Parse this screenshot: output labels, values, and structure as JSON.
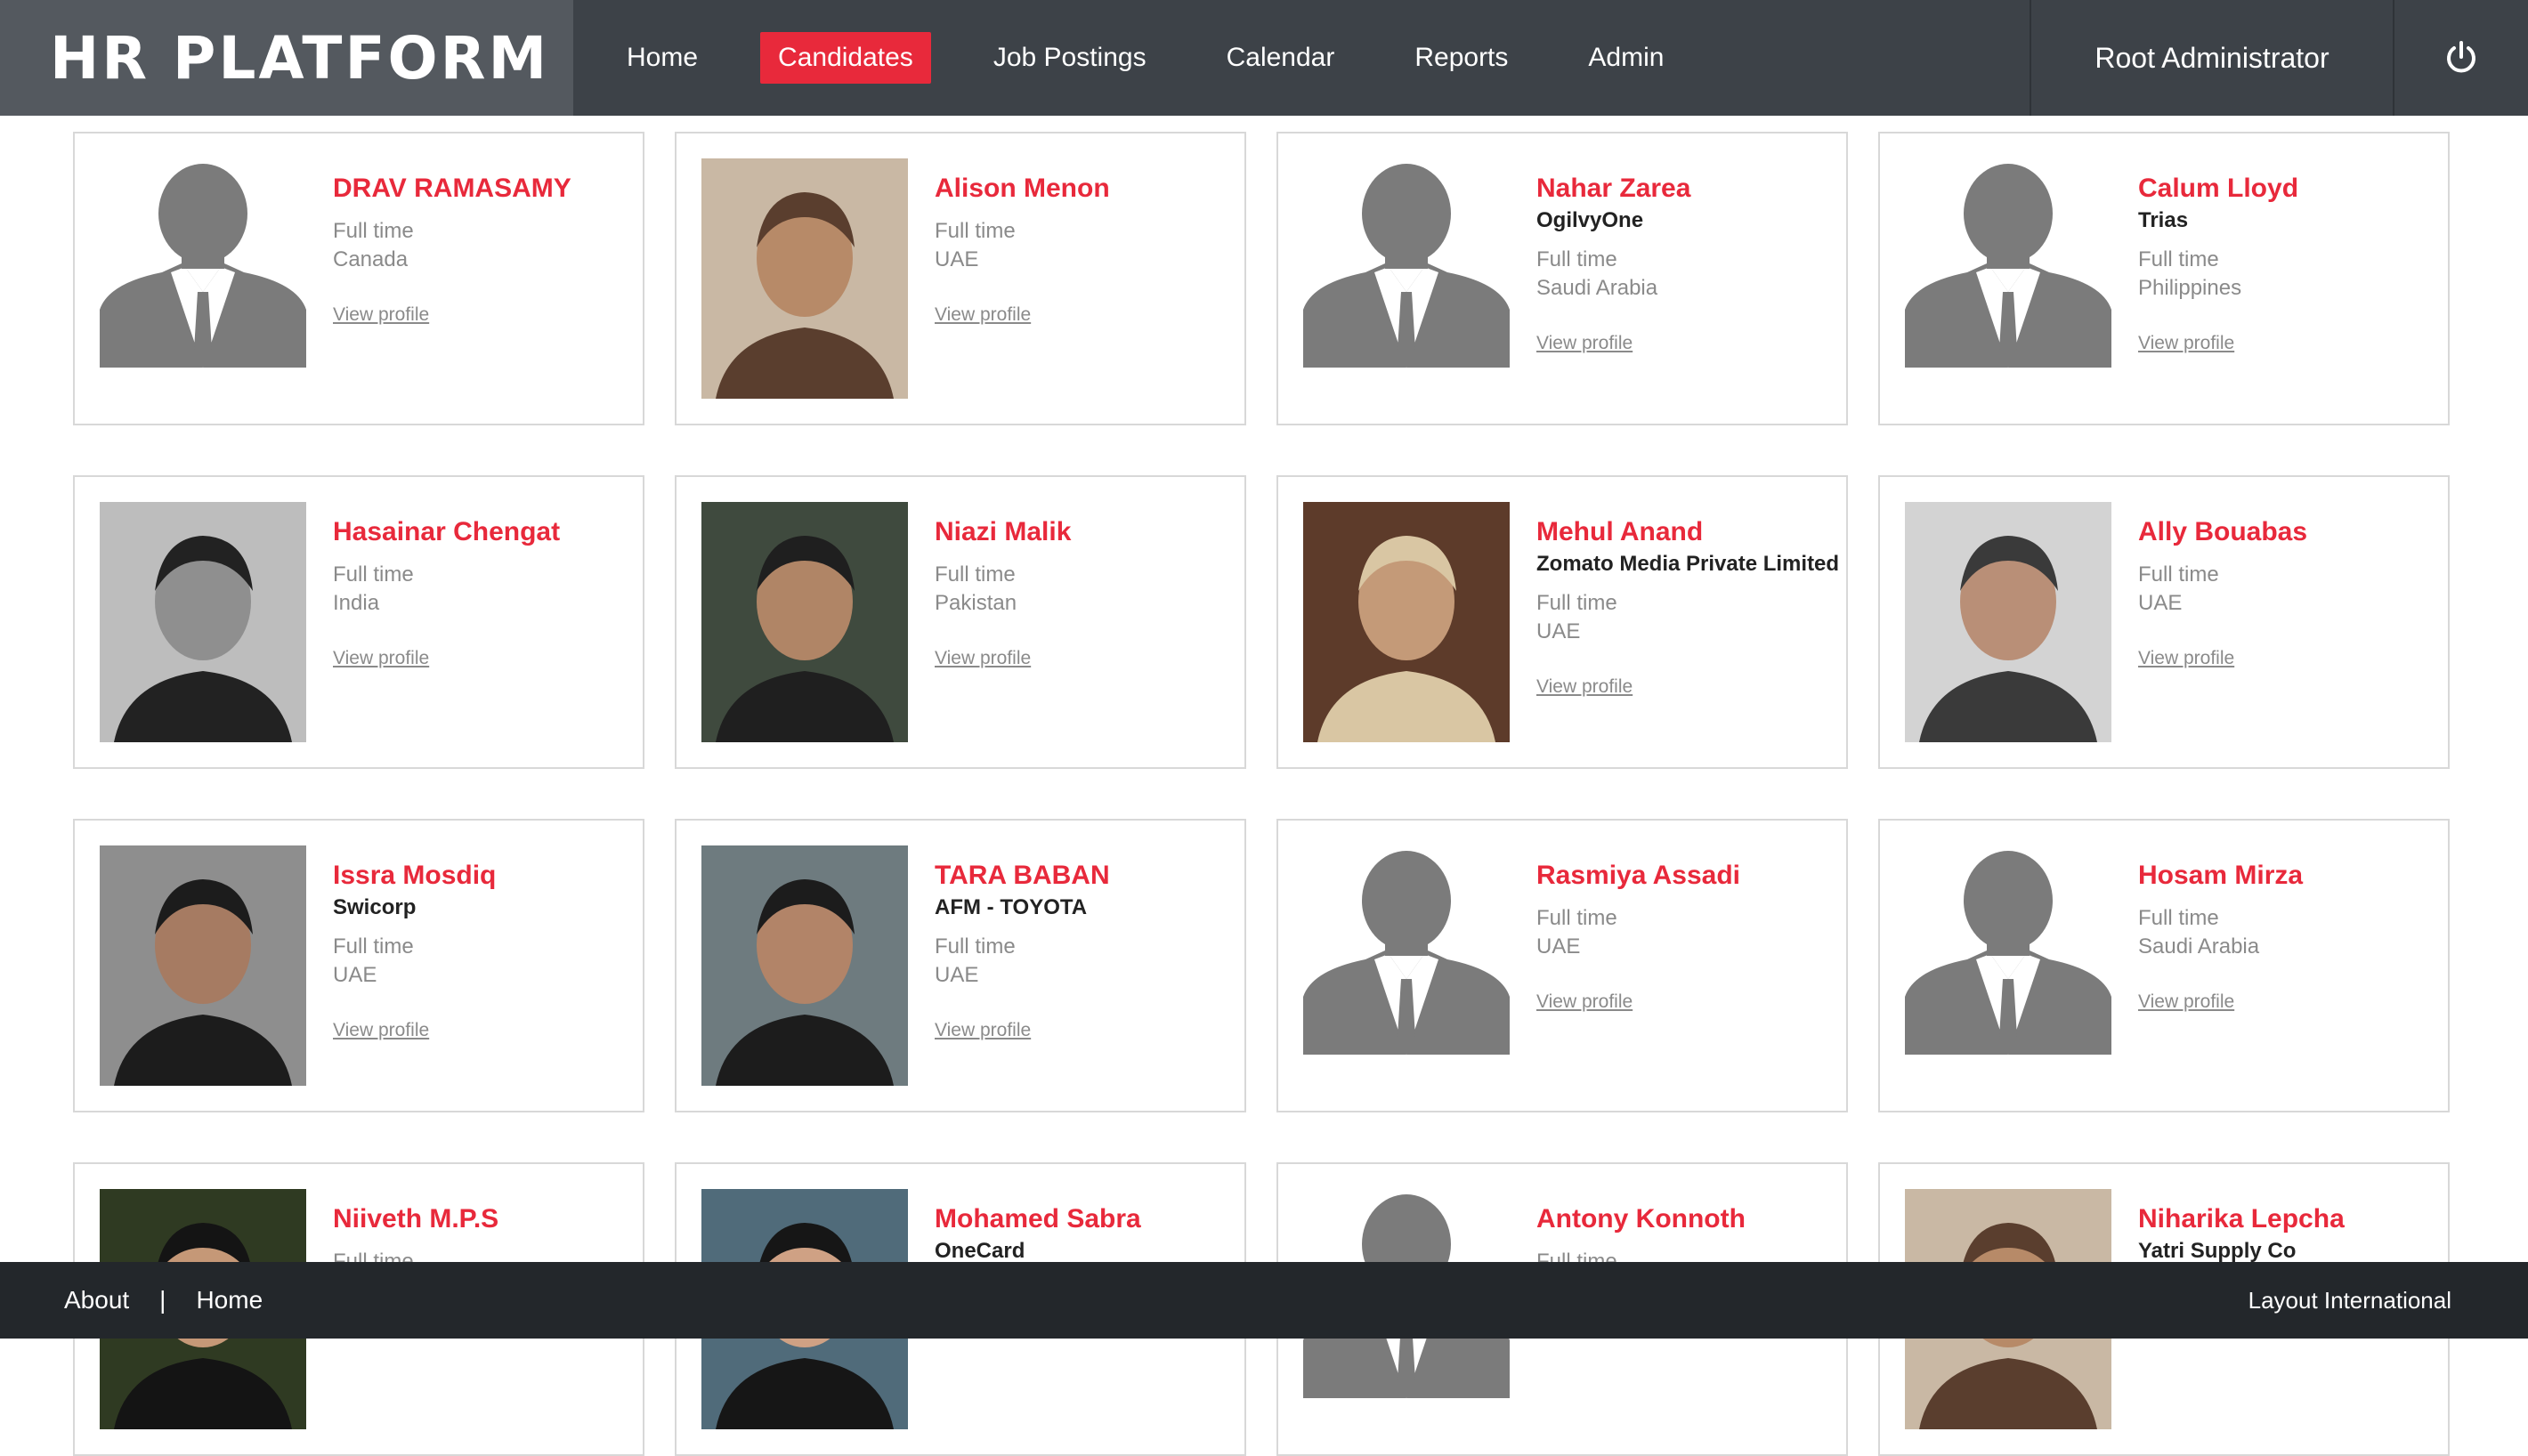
{
  "app": {
    "logo": "HR PLATFORM",
    "user": "Root Administrator"
  },
  "nav": [
    {
      "label": "Home",
      "active": false
    },
    {
      "label": "Candidates",
      "active": true
    },
    {
      "label": "Job Postings",
      "active": false
    },
    {
      "label": "Calendar",
      "active": false
    },
    {
      "label": "Reports",
      "active": false
    },
    {
      "label": "Admin",
      "active": false
    }
  ],
  "icons": {
    "power": "power-icon",
    "placeholder": "person-silhouette-icon"
  },
  "colors": {
    "accent": "#e8293b",
    "header": "#3d4248",
    "logo_bg": "#54595f",
    "footer": "#23272b",
    "silhouette": "#7b7b7b"
  },
  "candidates": [
    {
      "name": "DRAV RAMASAMY",
      "company": "",
      "type": "Full time",
      "location": "Canada",
      "link": "View profile",
      "photo": "placeholder"
    },
    {
      "name": "Alison Menon",
      "company": "",
      "type": "Full time",
      "location": "UAE",
      "link": "View profile",
      "photo": "photo"
    },
    {
      "name": "Nahar Zarea",
      "company": "OgilvyOne",
      "type": "Full time",
      "location": "Saudi Arabia",
      "link": "View profile",
      "photo": "placeholder"
    },
    {
      "name": "Calum Lloyd",
      "company": "Trias",
      "type": "Full time",
      "location": "Philippines",
      "link": "View profile",
      "photo": "placeholder"
    },
    {
      "name": "Hasainar Chengat",
      "company": "",
      "type": "Full time",
      "location": "India",
      "link": "View profile",
      "photo": "photo"
    },
    {
      "name": "Niazi Malik",
      "company": "",
      "type": "Full time",
      "location": "Pakistan",
      "link": "View profile",
      "photo": "photo"
    },
    {
      "name": "Mehul Anand",
      "company": "Zomato Media Private Limited",
      "type": "Full time",
      "location": "UAE",
      "link": "View profile",
      "photo": "photo"
    },
    {
      "name": "Ally Bouabas",
      "company": "",
      "type": "Full time",
      "location": "UAE",
      "link": "View profile",
      "photo": "photo"
    },
    {
      "name": "Issra Mosdiq",
      "company": "Swicorp",
      "type": "Full time",
      "location": "UAE",
      "link": "View profile",
      "photo": "photo"
    },
    {
      "name": "TARA BABAN",
      "company": "AFM - TOYOTA",
      "type": "Full time",
      "location": "UAE",
      "link": "View profile",
      "photo": "photo"
    },
    {
      "name": "Rasmiya Assadi",
      "company": "",
      "type": "Full time",
      "location": "UAE",
      "link": "View profile",
      "photo": "placeholder"
    },
    {
      "name": "Hosam Mirza",
      "company": "",
      "type": "Full time",
      "location": "Saudi Arabia",
      "link": "View profile",
      "photo": "placeholder"
    },
    {
      "name": "Niiveth M.P.S",
      "company": "",
      "type": "Full time",
      "location": "",
      "link": "",
      "photo": "photo"
    },
    {
      "name": "Mohamed Sabra",
      "company": "OneCard",
      "type": "",
      "location": "",
      "link": "",
      "photo": "photo"
    },
    {
      "name": "Antony Konnoth",
      "company": "",
      "type": "Full time",
      "location": "",
      "link": "",
      "photo": "placeholder"
    },
    {
      "name": "Niharika Lepcha",
      "company": "Yatri Supply Co",
      "type": "",
      "location": "",
      "link": "",
      "photo": "photo"
    }
  ],
  "footer": {
    "about": "About",
    "separator": "|",
    "home": "Home",
    "brand": "Layout International"
  }
}
